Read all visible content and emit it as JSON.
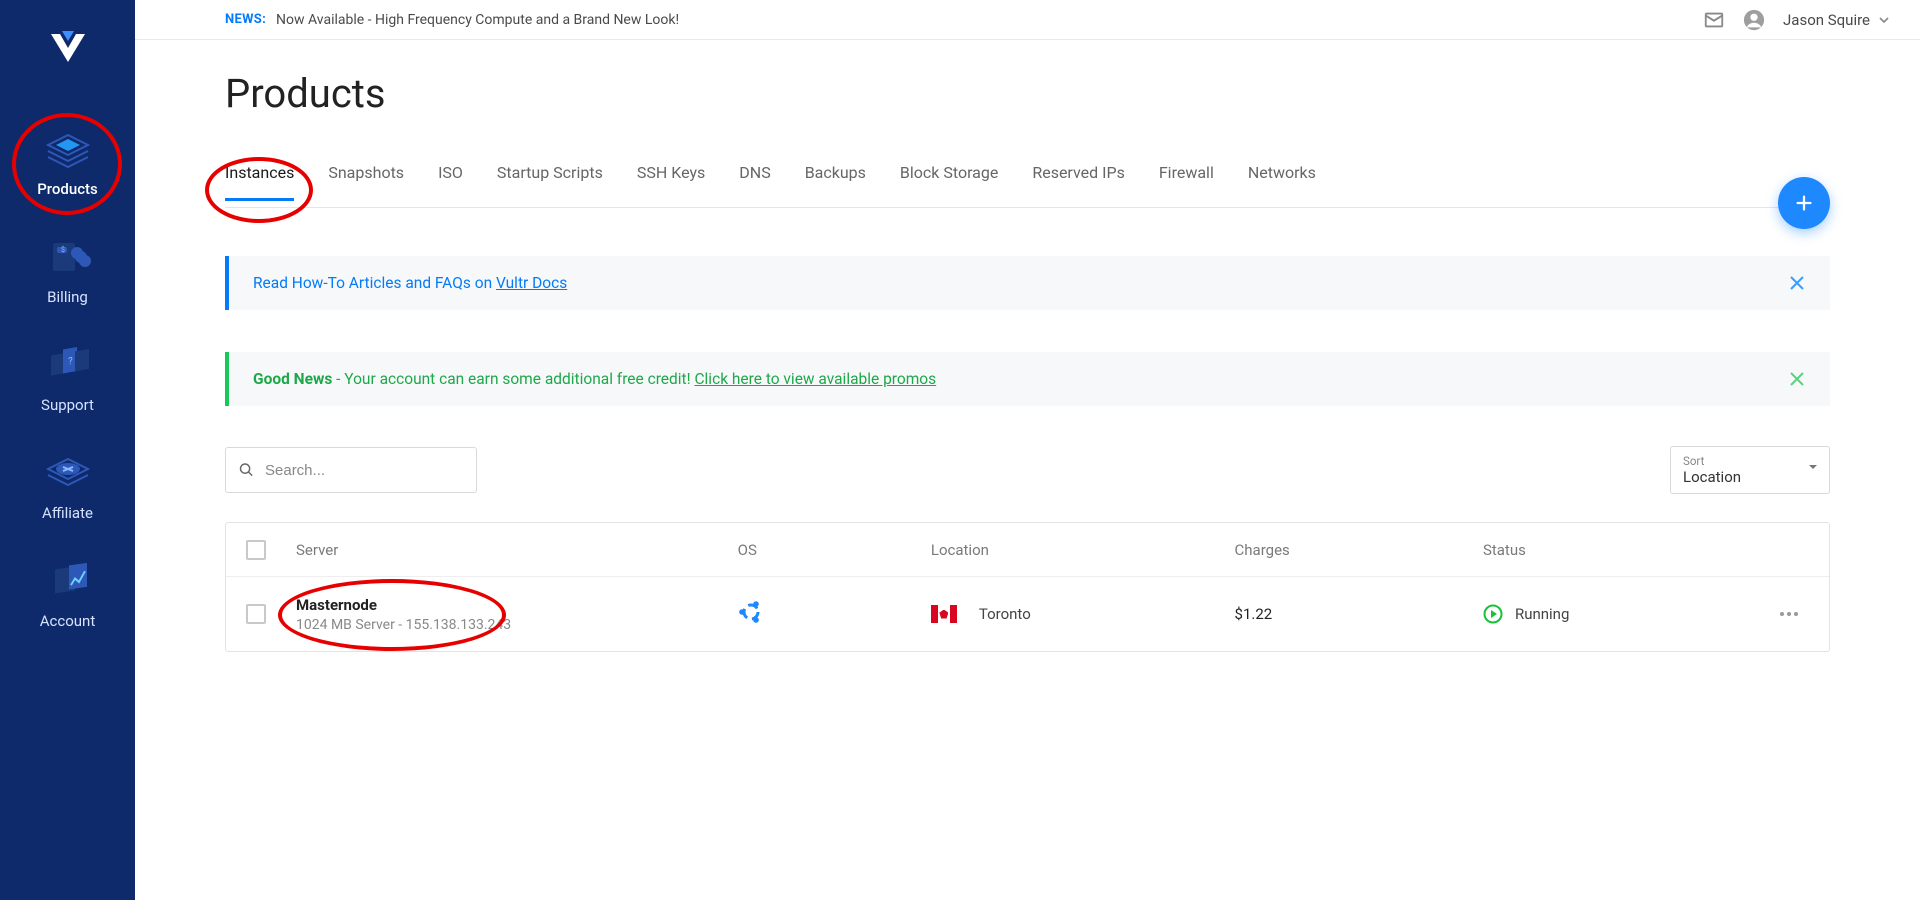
{
  "topbar": {
    "news_tag": "NEWS:",
    "news_text": "Now Available - High Frequency Compute and a Brand New Look!",
    "user_name": "Jason Squire"
  },
  "sidebar": {
    "items": [
      {
        "label": "Products"
      },
      {
        "label": "Billing"
      },
      {
        "label": "Support"
      },
      {
        "label": "Affiliate"
      },
      {
        "label": "Account"
      }
    ]
  },
  "page": {
    "title": "Products"
  },
  "tabs": [
    {
      "label": "Instances",
      "active": true
    },
    {
      "label": "Snapshots"
    },
    {
      "label": "ISO"
    },
    {
      "label": "Startup Scripts"
    },
    {
      "label": "SSH Keys"
    },
    {
      "label": "DNS"
    },
    {
      "label": "Backups"
    },
    {
      "label": "Block Storage"
    },
    {
      "label": "Reserved IPs"
    },
    {
      "label": "Firewall"
    },
    {
      "label": "Networks"
    }
  ],
  "banners": {
    "info_prefix": "Read How-To Articles and FAQs on ",
    "info_link": "Vultr Docs",
    "promo_strong": "Good News",
    "promo_text": " - Your account can earn some additional free credit!  ",
    "promo_link": "Click here to view available promos"
  },
  "toolbar": {
    "search_placeholder": "Search...",
    "sort_label": "Sort",
    "sort_value": "Location"
  },
  "table": {
    "headers": {
      "server": "Server",
      "os": "OS",
      "location": "Location",
      "charges": "Charges",
      "status": "Status"
    },
    "rows": [
      {
        "name": "Masternode",
        "subtitle": "1024 MB Server - 155.138.133.243",
        "os_icon": "ubuntu",
        "location": "Toronto",
        "flag": "canada",
        "charges": "$1.22",
        "status": "Running"
      }
    ]
  }
}
